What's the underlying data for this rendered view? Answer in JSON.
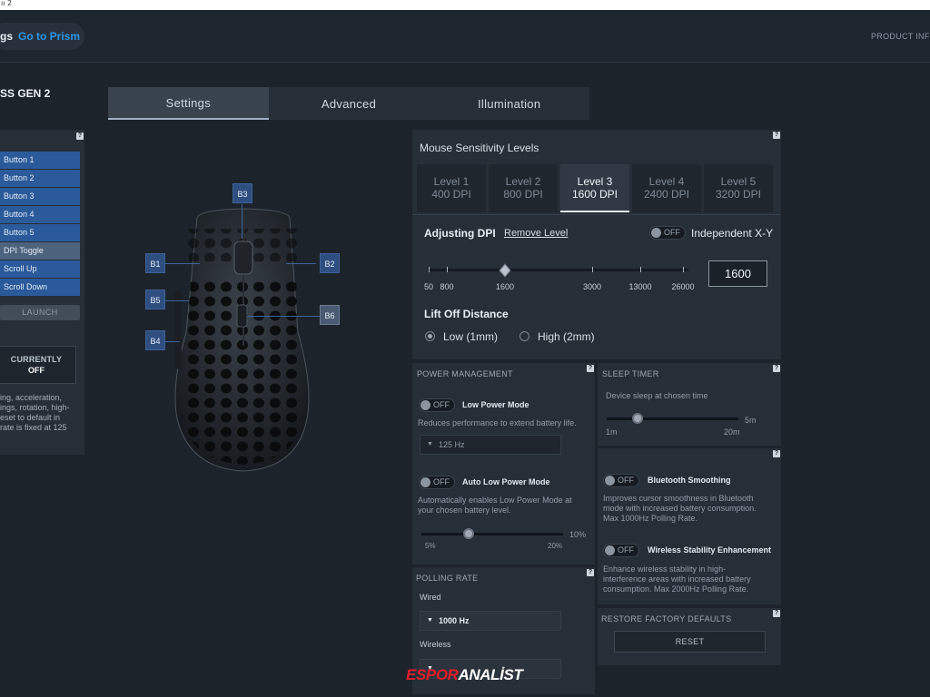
{
  "window": {
    "title_fragment": "ıı 2"
  },
  "header": {
    "fragment": "gs",
    "prism_link": "Go to Prism",
    "product_info": "PRODUCT INFO"
  },
  "device": {
    "name_fragment": "SS GEN 2"
  },
  "tabs": [
    {
      "label": "Settings",
      "active": true
    },
    {
      "label": "Advanced",
      "active": false
    },
    {
      "label": "Illumination",
      "active": false
    }
  ],
  "button_panel": {
    "help": "?",
    "items": [
      "Button 1",
      "Button 2",
      "Button 3",
      "Button 4",
      "Button 5",
      "DPI Toggle",
      "Scroll Up",
      "Scroll Down"
    ],
    "launch": "LAUNCH",
    "currently_label": "CURRENTLY",
    "currently_value": "OFF",
    "desc_lines": [
      "ing, acceleration,",
      "ings, rotation, high-",
      "eset to default in",
      "rate is fixed at 125"
    ]
  },
  "mouse_tags": [
    "B1",
    "B2",
    "B3",
    "B4",
    "B5",
    "B6"
  ],
  "sensitivity": {
    "help": "?",
    "title": "Mouse Sensitivity Levels",
    "levels": [
      {
        "name": "Level 1",
        "dpi": "400 DPI",
        "active": false
      },
      {
        "name": "Level 2",
        "dpi": "800 DPI",
        "active": false
      },
      {
        "name": "Level 3",
        "dpi": "1600 DPI",
        "active": true
      },
      {
        "name": "Level 4",
        "dpi": "2400 DPI",
        "active": false
      },
      {
        "name": "Level 5",
        "dpi": "3200 DPI",
        "active": false
      }
    ],
    "adjusting": "Adjusting DPI",
    "remove": "Remove Level",
    "independent_toggle": "OFF",
    "independent_label": "Independent X-Y",
    "ticks": [
      "50",
      "800",
      "1600",
      "3000",
      "13000",
      "26000"
    ],
    "dpi_value": "1600",
    "lift_off_title": "Lift Off Distance",
    "lift_options": [
      {
        "label": "Low (1mm)",
        "selected": true
      },
      {
        "label": "High (2mm)",
        "selected": false
      }
    ]
  },
  "power": {
    "help": "?",
    "title": "POWER MANAGEMENT",
    "low_power_toggle": "OFF",
    "low_power_label": "Low Power Mode",
    "low_power_desc": "Reduces performance to extend battery life.",
    "low_power_rate": "125 Hz",
    "auto_toggle": "OFF",
    "auto_label": "Auto Low Power Mode",
    "auto_desc_1": "Automatically enables Low Power Mode at",
    "auto_desc_2": "your chosen battery level.",
    "auto_pct_value": 10,
    "auto_pct": "10%",
    "auto_min": "5%",
    "auto_max": "20%"
  },
  "polling": {
    "help": "?",
    "title": "POLLING RATE",
    "wired_label": "Wired",
    "wired_value": "1000 Hz",
    "wireless_label": "Wireless"
  },
  "sleep": {
    "help": "?",
    "title": "SLEEP TIMER",
    "desc": "Device sleep at chosen time",
    "value": "5m",
    "min": "1m",
    "max": "20m"
  },
  "bluetooth": {
    "help": "?",
    "toggle": "OFF",
    "label": "Bluetooth Smoothing",
    "desc_1": "Improves cursor smoothness in Bluetooth",
    "desc_2": "mode with increased battery consumption.",
    "desc_3": "Max 1000Hz Polling Rate."
  },
  "wireless_stab": {
    "toggle": "OFF",
    "label": "Wireless Stability Enhancement",
    "desc_1": "Enhance wireless stability in high-",
    "desc_2": "interference areas with increased battery",
    "desc_3": "consumption. Max 2000Hz Polling Rate."
  },
  "restore": {
    "help": "?",
    "title": "RESTORE FACTORY DEFAULTS",
    "button": "RESET"
  },
  "watermark": {
    "part1": "ESPOR",
    "part2": "ANALİST"
  }
}
